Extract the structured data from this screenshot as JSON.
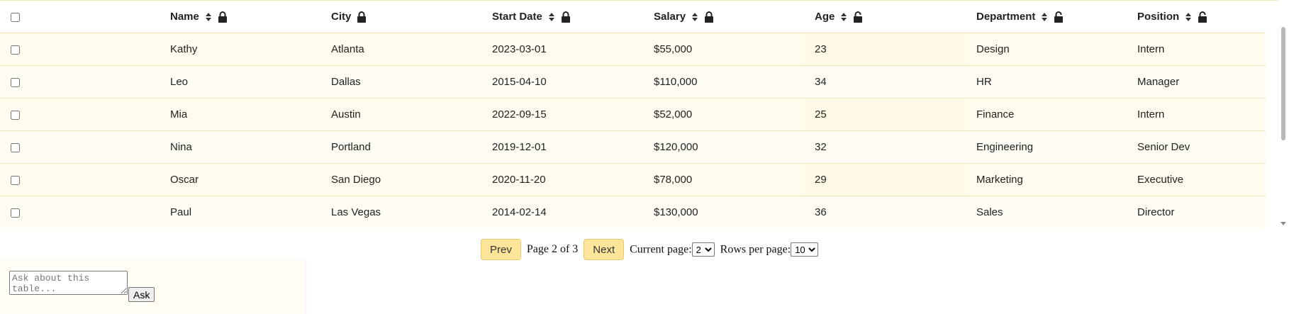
{
  "table": {
    "columns": [
      {
        "label": "Name",
        "sortable": true,
        "lock": "locked"
      },
      {
        "label": "City",
        "sortable": false,
        "lock": "locked"
      },
      {
        "label": "Start Date",
        "sortable": true,
        "lock": "locked"
      },
      {
        "label": "Salary",
        "sortable": true,
        "lock": "locked"
      },
      {
        "label": "Age",
        "sortable": true,
        "lock": "unlocked"
      },
      {
        "label": "Department",
        "sortable": true,
        "lock": "unlocked"
      },
      {
        "label": "Position",
        "sortable": true,
        "lock": "unlocked"
      }
    ],
    "rows": [
      [
        "Kathy",
        "Atlanta",
        "2023-03-01",
        "$55,000",
        "23",
        "Design",
        "Intern"
      ],
      [
        "Leo",
        "Dallas",
        "2015-04-10",
        "$110,000",
        "34",
        "HR",
        "Manager"
      ],
      [
        "Mia",
        "Austin",
        "2022-09-15",
        "$52,000",
        "25",
        "Finance",
        "Intern"
      ],
      [
        "Nina",
        "Portland",
        "2019-12-01",
        "$120,000",
        "32",
        "Engineering",
        "Senior Dev"
      ],
      [
        "Oscar",
        "San Diego",
        "2020-11-20",
        "$78,000",
        "29",
        "Marketing",
        "Executive"
      ],
      [
        "Paul",
        "Las Vegas",
        "2014-02-14",
        "$130,000",
        "36",
        "Sales",
        "Director"
      ]
    ]
  },
  "pagination": {
    "prev_label": "Prev",
    "page_info": "Page 2 of 3",
    "next_label": "Next",
    "current_page_label": "Current page:",
    "current_page_value": "2",
    "rows_per_page_label": "Rows per page:",
    "rows_per_page_value": "10"
  },
  "ask": {
    "placeholder": "Ask about this table...",
    "button_label": "Ask"
  },
  "colors": {
    "accent": "#ffe599",
    "row_tint": "#fffbee",
    "border": "#f1e6b8"
  },
  "icons": {
    "sort": "sort-icon",
    "locked": "lock-icon",
    "unlocked": "unlock-icon"
  }
}
